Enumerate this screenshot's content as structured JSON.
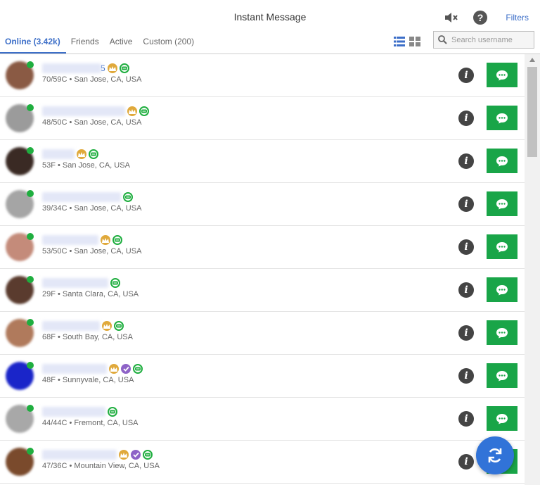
{
  "header": {
    "title": "Instant Message",
    "filters_label": "Filters",
    "mute_icon": "speaker-muted-icon",
    "help_icon": "help-icon"
  },
  "tabs": [
    {
      "label": "Online (3.42k)",
      "active": true
    },
    {
      "label": "Friends",
      "active": false
    },
    {
      "label": "Active",
      "active": false
    },
    {
      "label": "Custom (200)",
      "active": false
    }
  ],
  "view_modes": {
    "list_icon": "list-view-icon",
    "grid_icon": "grid-view-icon",
    "selected": "list"
  },
  "search": {
    "placeholder": "Search username",
    "value": ""
  },
  "colors": {
    "accent": "#3d6fc8",
    "online": "#1fae3f",
    "message_button": "#19a548",
    "crown_badge": "#e0a93b",
    "verified_badge": "#8e63c7",
    "refresh_button": "#3173d8"
  },
  "users": [
    {
      "name_visible": "5",
      "details": "70/59C • San Jose, CA, USA",
      "badges": [
        "crown",
        "chat"
      ],
      "avatar_color": "#8a5a44"
    },
    {
      "name_visible": "",
      "details": "48/50C • San Jose, CA, USA",
      "badges": [
        "crown",
        "chat"
      ],
      "avatar_color": "#9b9b9b"
    },
    {
      "name_visible": "",
      "details": "53F • San Jose, CA, USA",
      "badges": [
        "crown",
        "chat"
      ],
      "avatar_color": "#3a2a24"
    },
    {
      "name_visible": "",
      "details": "39/34C • San Jose, CA, USA",
      "badges": [
        "chat"
      ],
      "avatar_color": "#a5a5a5"
    },
    {
      "name_visible": "",
      "details": "53/50C • San Jose, CA, USA",
      "badges": [
        "crown",
        "chat"
      ],
      "avatar_color": "#c48b7a"
    },
    {
      "name_visible": "",
      "details": "29F • Santa Clara, CA, USA",
      "badges": [
        "chat"
      ],
      "avatar_color": "#5a3b2e"
    },
    {
      "name_visible": "",
      "details": "68F • South Bay, CA, USA",
      "badges": [
        "crown",
        "chat"
      ],
      "avatar_color": "#b07a5c"
    },
    {
      "name_visible": "",
      "details": "48F • Sunnyvale, CA, USA",
      "badges": [
        "crown",
        "verified",
        "chat"
      ],
      "avatar_color": "#1a25c9"
    },
    {
      "name_visible": "",
      "details": "44/44C • Fremont, CA, USA",
      "badges": [
        "chat"
      ],
      "avatar_color": "#a8a8a8"
    },
    {
      "name_visible": "",
      "details": "47/36C • Mountain View, CA, USA",
      "badges": [
        "crown",
        "verified",
        "chat"
      ],
      "avatar_color": "#7a4a2c"
    }
  ],
  "row_actions": {
    "info_icon": "info-icon",
    "message_icon": "chat-bubble-icon"
  },
  "refresh_icon": "refresh-icon"
}
